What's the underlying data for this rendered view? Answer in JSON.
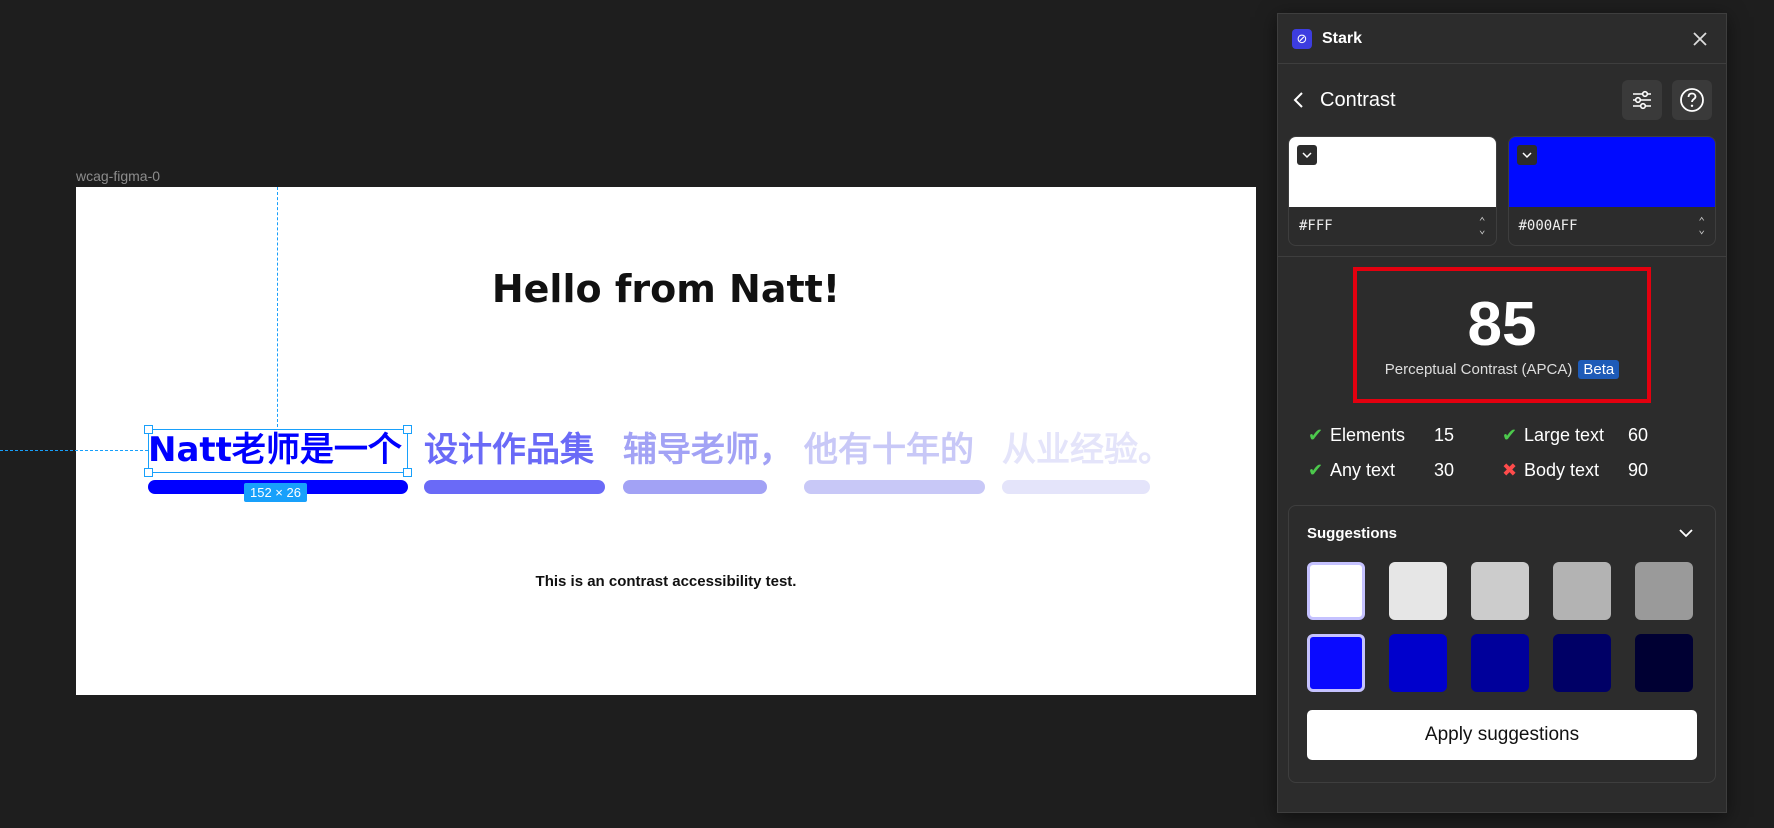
{
  "canvas": {
    "frame_label": "wcag-figma-0",
    "title": "Hello from Natt!",
    "footer": "This is an contrast accessibility test.",
    "selection_size": "152 × 26",
    "cjk_items": [
      {
        "text": "Natt老师是一个",
        "color": "#0000FF"
      },
      {
        "text": "设计作品集",
        "color": "#6A6AF7"
      },
      {
        "text": "辅导老师，",
        "color": "#A2A2F5"
      },
      {
        "text": "他有十年的",
        "color": "#C8C8F7"
      },
      {
        "text": "从业经验。",
        "color": "#E4E4FA"
      }
    ]
  },
  "panel": {
    "app_name": "Stark",
    "section_title": "Contrast",
    "foreground": {
      "hex": "#FFF",
      "color": "#FFFFFF"
    },
    "background": {
      "hex": "#000AFF",
      "color": "#000AFF"
    },
    "score": {
      "value": "85",
      "label": "Perceptual Contrast (APCA)",
      "badge": "Beta"
    },
    "results": [
      {
        "label": "Elements",
        "value": "15",
        "pass": true
      },
      {
        "label": "Large text",
        "value": "60",
        "pass": true
      },
      {
        "label": "Any text",
        "value": "30",
        "pass": true
      },
      {
        "label": "Body text",
        "value": "90",
        "pass": false
      }
    ],
    "suggestions": {
      "title": "Suggestions",
      "swatches": [
        "#FFFFFF",
        "#E6E6E6",
        "#CCCCCC",
        "#B3B3B3",
        "#9A9A9A",
        "#0A0AFF",
        "#0000CC",
        "#00009B",
        "#000066",
        "#000033"
      ],
      "apply_label": "Apply suggestions"
    },
    "colors": {
      "pass": "#4CC94C",
      "fail": "#FF4B4B",
      "alert": "#E3000F"
    }
  }
}
